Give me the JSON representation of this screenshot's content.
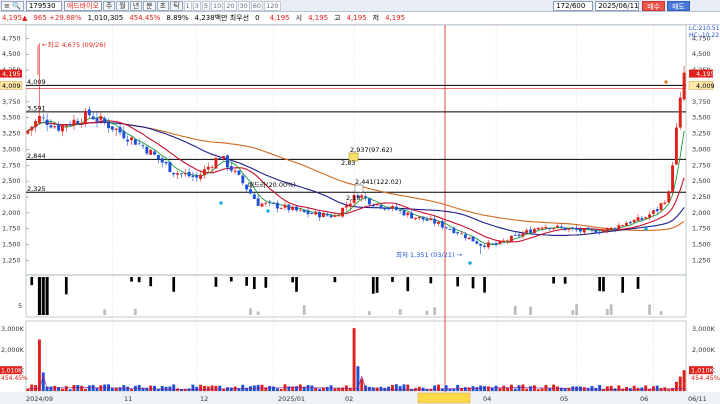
{
  "toolbar": {
    "menu_label": "≡ 🔍",
    "stock_code": "179530",
    "stock_name": "애드바이오",
    "period_buttons": [
      "주",
      "월",
      "년",
      "분",
      "초",
      "틱"
    ],
    "minute_buttons": [
      "1",
      "3",
      "5",
      "10",
      "20",
      "30",
      "60",
      "120"
    ],
    "count_value": "172/600",
    "date_value": "2025/06/11",
    "buy_label": "매수",
    "sell_label": "매도"
  },
  "info": {
    "price": "4,195",
    "change": "965 +29.88%",
    "volume": "1,010,305",
    "volume_ratio": "454.45%",
    "turnover": "8.89%",
    "amount": "4,238백만 최우선",
    "best_qty": "0",
    "best_price": "4,195",
    "open_label": "시",
    "open": "4,195",
    "high_label": "고",
    "high": "4,195",
    "low_label": "저",
    "low": "4,195"
  },
  "price_axis": {
    "ticks": [
      "4,750",
      "4,500",
      "4,250",
      "4,000",
      "3,750",
      "3,500",
      "3,250",
      "3,000",
      "2,750",
      "2,500",
      "2,250",
      "2,000",
      "1,750",
      "1,500",
      "1,250"
    ],
    "current_tag": "4,195",
    "prev_tag": "4,009",
    "lc_label": "LC:210.51",
    "hc_label": "HC:-10.22"
  },
  "levels": [
    {
      "label": "4,009",
      "price": 4009
    },
    {
      "label": "3,591",
      "price": 3591
    },
    {
      "label": "2,844",
      "price": 2844
    },
    {
      "label": "2,325",
      "price": 2325
    }
  ],
  "annotations": {
    "high": "최고 4,675 (09/26)",
    "low": "최저 1,351 (03/21)",
    "a1": "2,937(97.62)",
    "a2": "2,441(122.02)",
    "a3": "배드라(20.00%)",
    "a4": "2,83",
    "a5": "2,18"
  },
  "volume_axis": {
    "ticks": [
      "3,000K",
      "2,000K",
      "1,000K"
    ],
    "tag1": "1,010K",
    "tag2": "454.45%"
  },
  "mid_axis": {
    "tick": "5"
  },
  "x_axis": {
    "labels": [
      "2024/09",
      "11",
      "12",
      "2025/01",
      "02",
      "03",
      "04",
      "05",
      "06",
      "06/11"
    ]
  },
  "colors": {
    "up": "#e0201b",
    "down": "#1b4fd8",
    "ma_orange": "#d2691e",
    "ma_navy": "#1c1f8c",
    "ma_red": "#c8102e",
    "ma_green": "#1a9e3a"
  }
}
